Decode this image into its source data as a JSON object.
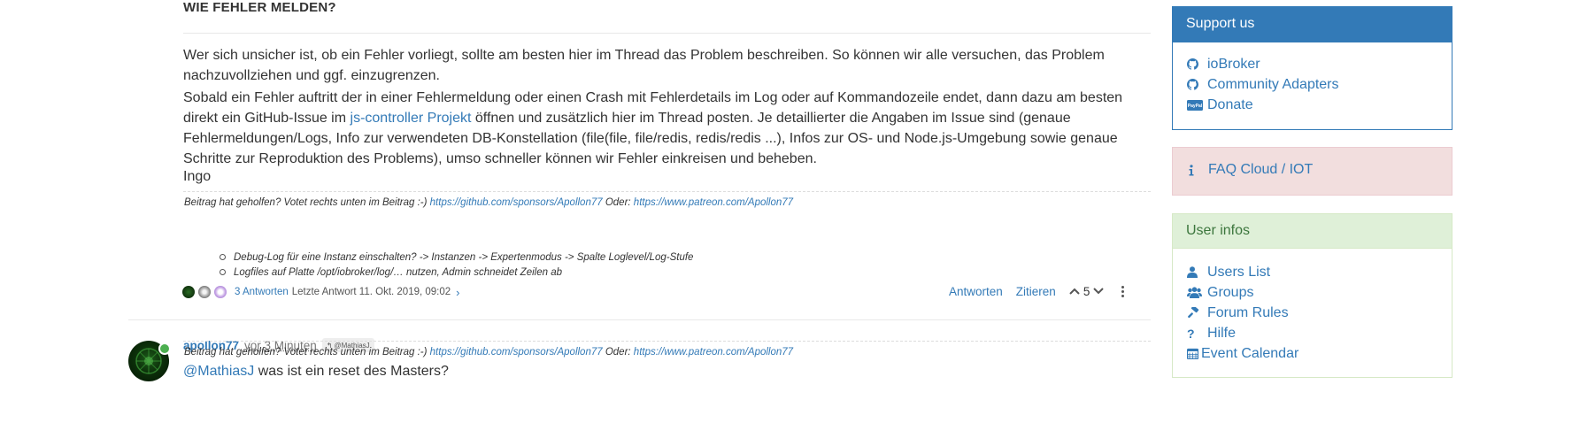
{
  "post": {
    "heading": "WIE FEHLER MELDEN?",
    "para1": "Wer sich unsicher ist, ob ein Fehler vorliegt, sollte am besten hier im Thread das Problem beschreiben. So können wir alle versuchen, das Problem nachzuvollziehen und ggf. einzugrenzen.",
    "para2_before": "Sobald ein Fehler auftritt der in einer Fehlermeldung oder einen Crash mit Fehlerdetails im Log oder auf Kommandozeile endet, dann dazu am besten direkt ein GitHub-Issue im ",
    "para2_link": "js-controller Projekt",
    "para2_after": " öffnen und zusätzlich hier im Thread posten. Je detaillierter die Angaben im Issue sind (genaue Fehlermeldungen/Logs, Info zur verwendeten DB-Konstellation (file(file, file/redis, redis/redis ...), Infos zur OS- und Node.js-Umgebung sowie genaue Schritte zur Reproduktion des Problems), umso schneller können wir Fehler einkreisen und beheben.",
    "sign": "Ingo",
    "signature": {
      "prefix": "Beitrag hat geholfen? Votet rechts unten im Beitrag :-) ",
      "link1": "https://github.com/sponsors/Apollon77",
      "middle": " Oder: ",
      "link2": "https://www.patreon.com/Apollon77"
    },
    "tips": [
      "Debug-Log für eine Instanz einschalten? -> Instanzen -> Expertenmodus -> Spalte Loglevel/Log-Stufe",
      "Logfiles auf Platte /opt/iobroker/log/… nutzen, Admin schneidet Zeilen ab"
    ],
    "replies": {
      "count_label": "3 Antworten",
      "last_label": "Letzte Antwort 11. Okt. 2019, 09:02"
    },
    "actions": {
      "reply": "Antworten",
      "quote": "Zitieren",
      "votes": "5"
    }
  },
  "post2": {
    "author": "apollon77",
    "timeago": "vor 3 Minuten",
    "reply_to": "@MathiasJ",
    "mention": "@MathiasJ",
    "body": " was ist ein reset des Masters?",
    "online_color": "#4caf50"
  },
  "sidebar": {
    "support": {
      "title": "Support us",
      "items": [
        {
          "label": "ioBroker",
          "icon": "github-icon"
        },
        {
          "label": "Community Adapters",
          "icon": "github-icon"
        },
        {
          "label": "Donate",
          "icon": "paypal-icon"
        }
      ]
    },
    "faq": {
      "label": "FAQ Cloud / IOT",
      "icon": "info-icon"
    },
    "user": {
      "title": "User infos",
      "items": [
        {
          "label": "Users List",
          "icon": "user-icon"
        },
        {
          "label": "Groups",
          "icon": "users-icon"
        },
        {
          "label": "Forum Rules",
          "icon": "gavel-icon"
        },
        {
          "label": "Hilfe",
          "icon": "question-icon"
        },
        {
          "label": "Event Calendar",
          "icon": "calendar-icon"
        }
      ]
    }
  },
  "colors": {
    "link": "#337ab7",
    "support_header": "#337ab7",
    "faq_bg": "#f2dede",
    "user_header_bg": "#dff0d8",
    "user_header_text": "#3c763d"
  }
}
